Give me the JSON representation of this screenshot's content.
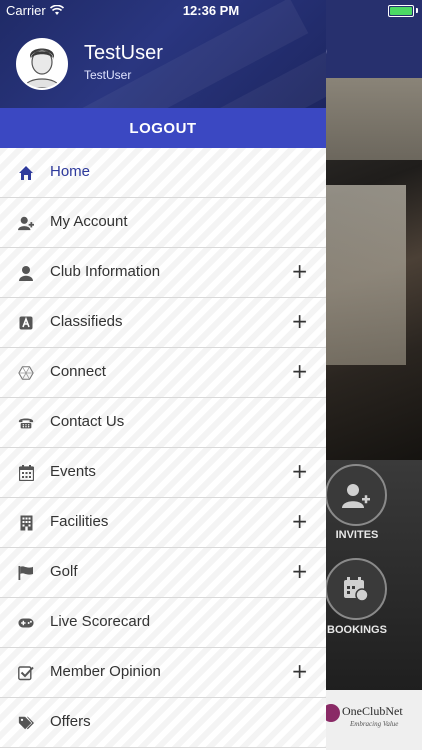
{
  "status_bar": {
    "carrier": "Carrier",
    "time": "12:36 PM",
    "battery_level": 1.0,
    "battery_color": "#4cd964"
  },
  "background": {
    "header_partial_title": "b",
    "invites_label": "INVITES",
    "bookings_label": "BOOKINGS",
    "logo_text": "OneClubNet",
    "logo_sub": "Embracing Value"
  },
  "user": {
    "name": "TestUser",
    "subtitle": "TestUser"
  },
  "logout_label": "LOGOUT",
  "menu": [
    {
      "label": "Home",
      "icon": "home-icon",
      "expandable": false,
      "active": true
    },
    {
      "label": "My Account",
      "icon": "user-plus-icon",
      "expandable": false
    },
    {
      "label": "Club Information",
      "icon": "user-icon",
      "expandable": true
    },
    {
      "label": "Classifieds",
      "icon": "classifieds-icon",
      "expandable": true
    },
    {
      "label": "Connect",
      "icon": "hexagon-connect-icon",
      "expandable": true
    },
    {
      "label": "Contact Us",
      "icon": "phone-icon",
      "expandable": false
    },
    {
      "label": "Events",
      "icon": "calendar-icon",
      "expandable": true
    },
    {
      "label": "Facilities",
      "icon": "building-icon",
      "expandable": true
    },
    {
      "label": "Golf",
      "icon": "flag-icon",
      "expandable": true
    },
    {
      "label": "Live Scorecard",
      "icon": "gamepad-icon",
      "expandable": false
    },
    {
      "label": "Member Opinion",
      "icon": "checkbox-icon",
      "expandable": true
    },
    {
      "label": "Offers",
      "icon": "tags-icon",
      "expandable": false
    }
  ],
  "expand_symbol": "+",
  "colors": {
    "accent": "#3b48c2",
    "header": "#27306e",
    "active": "#2e3a9c"
  }
}
